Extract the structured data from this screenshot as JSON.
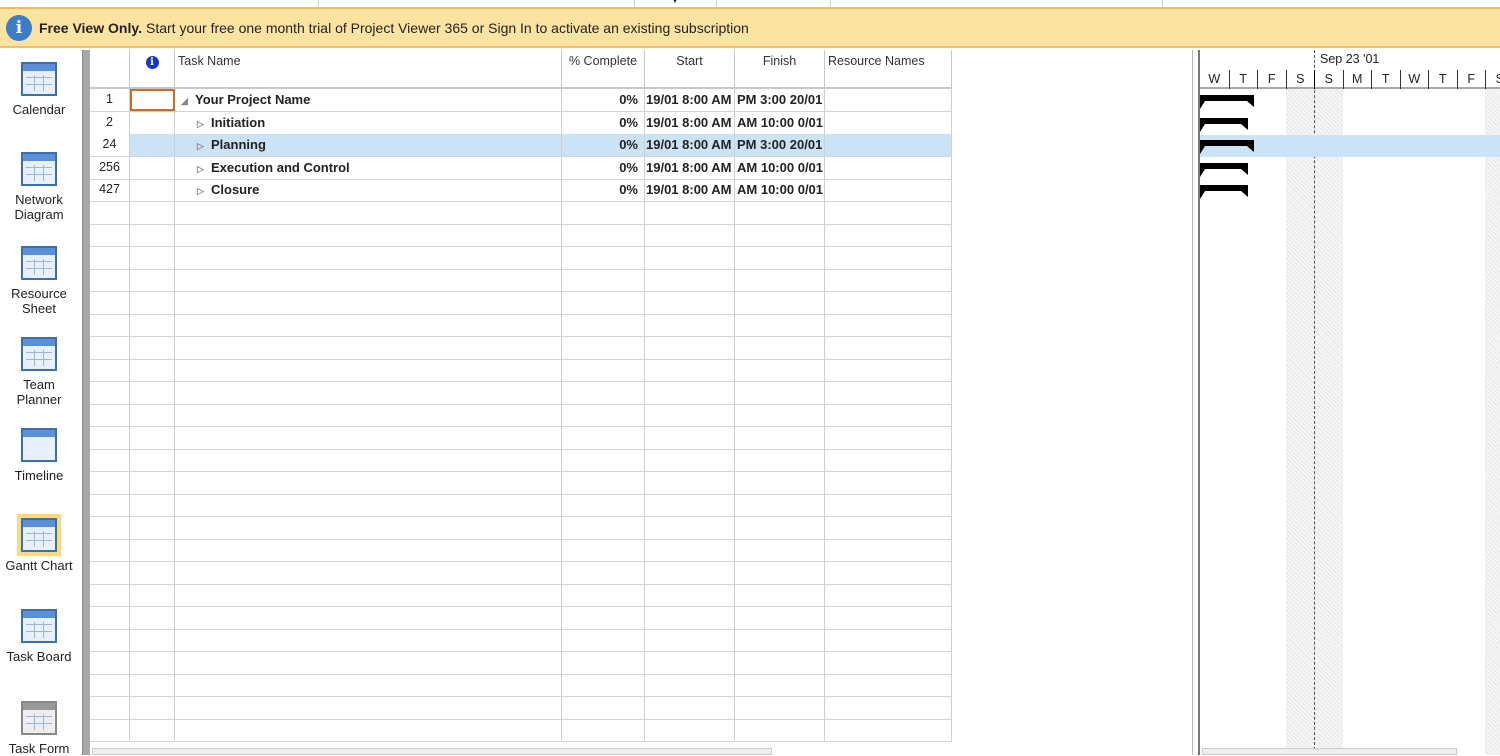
{
  "banner": {
    "bold": "Free View Only.",
    "text": "Start your free one month trial of Project Viewer 365 or Sign In to activate an existing subscription"
  },
  "sidebar": {
    "items": [
      {
        "label": "Calendar"
      },
      {
        "label": "Network Diagram"
      },
      {
        "label": "Resource Sheet"
      },
      {
        "label": "Team Planner"
      },
      {
        "label": "Timeline"
      },
      {
        "label": "Gantt Chart",
        "selected": true
      },
      {
        "label": "Task Board"
      },
      {
        "label": "Task Form"
      }
    ]
  },
  "table": {
    "headers": {
      "info": "i",
      "name": "Task Name",
      "pct": "% Complete",
      "start": "Start",
      "finish": "Finish",
      "resources": "Resource Names"
    },
    "rows": [
      {
        "id": "1",
        "name": "Your Project Name",
        "expand": "◢",
        "pct": "0%",
        "start": "19/01 8:00 AM",
        "finish": "20/01 3:00 PM",
        "resources": "",
        "level": 0
      },
      {
        "id": "2",
        "name": "Initiation",
        "expand": "▷",
        "pct": "0%",
        "start": "19/01 8:00 AM",
        "finish": "0/01 10:00 AM",
        "resources": "",
        "level": 1
      },
      {
        "id": "24",
        "name": "Planning",
        "expand": "▷",
        "pct": "0%",
        "start": "19/01 8:00 AM",
        "finish": "20/01 3:00 PM",
        "resources": "",
        "level": 1
      },
      {
        "id": "256",
        "name": "Execution and Control",
        "expand": "▷",
        "pct": "0%",
        "start": "19/01 8:00 AM",
        "finish": "0/01 10:00 AM",
        "resources": "",
        "level": 1
      },
      {
        "id": "427",
        "name": "Closure",
        "expand": "▷",
        "pct": "0%",
        "start": "19/01 8:00 AM",
        "finish": "0/01 10:00 AM",
        "resources": "",
        "level": 1
      }
    ]
  },
  "gantt": {
    "week_label": "Sep 23 '01",
    "days": [
      "W",
      "T",
      "F",
      "S",
      "S",
      "M",
      "T",
      "W",
      "T",
      "F",
      "S"
    ],
    "selected_row": 2
  }
}
